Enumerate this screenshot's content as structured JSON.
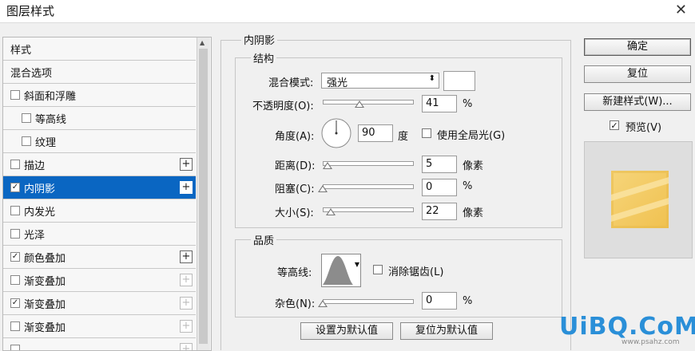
{
  "window": {
    "title": "图层样式",
    "close_symbol": "✕"
  },
  "style_list": [
    {
      "label": "样式",
      "has_checkbox": false,
      "checked": false,
      "indent": 0,
      "plus": "none",
      "selected": false
    },
    {
      "label": "混合选项",
      "has_checkbox": false,
      "checked": false,
      "indent": 0,
      "plus": "none",
      "selected": false
    },
    {
      "label": "斜面和浮雕",
      "has_checkbox": true,
      "checked": false,
      "indent": 0,
      "plus": "none",
      "selected": false
    },
    {
      "label": "等高线",
      "has_checkbox": true,
      "checked": false,
      "indent": 1,
      "plus": "none",
      "selected": false
    },
    {
      "label": "纹理",
      "has_checkbox": true,
      "checked": false,
      "indent": 1,
      "plus": "none",
      "selected": false
    },
    {
      "label": "描边",
      "has_checkbox": true,
      "checked": false,
      "indent": 0,
      "plus": "active",
      "selected": false
    },
    {
      "label": "内阴影",
      "has_checkbox": true,
      "checked": true,
      "indent": 0,
      "plus": "active",
      "selected": true
    },
    {
      "label": "内发光",
      "has_checkbox": true,
      "checked": false,
      "indent": 0,
      "plus": "none",
      "selected": false
    },
    {
      "label": "光泽",
      "has_checkbox": true,
      "checked": false,
      "indent": 0,
      "plus": "none",
      "selected": false
    },
    {
      "label": "颜色叠加",
      "has_checkbox": true,
      "checked": true,
      "indent": 0,
      "plus": "active",
      "selected": false
    },
    {
      "label": "渐变叠加",
      "has_checkbox": true,
      "checked": false,
      "indent": 0,
      "plus": "dim",
      "selected": false
    },
    {
      "label": "渐变叠加",
      "has_checkbox": true,
      "checked": true,
      "indent": 0,
      "plus": "dim",
      "selected": false
    },
    {
      "label": "渐变叠加",
      "has_checkbox": true,
      "checked": false,
      "indent": 0,
      "plus": "dim",
      "selected": false
    },
    {
      "label": "",
      "has_checkbox": true,
      "checked": false,
      "indent": 0,
      "plus": "dim",
      "selected": false
    }
  ],
  "section_title": "内阴影",
  "structure": {
    "legend": "结构",
    "blend_mode": {
      "label": "混合模式:",
      "value": "强光"
    },
    "opacity": {
      "label": "不透明度(O):",
      "value": "41",
      "unit": "%",
      "level": 0.41
    },
    "angle": {
      "label": "角度(A):",
      "value": "90",
      "unit": "度",
      "global_light_label": "使用全局光(G)",
      "global_light_checked": false
    },
    "distance": {
      "label": "距离(D):",
      "value": "5",
      "unit": "像素",
      "level": 0.05
    },
    "choke": {
      "label": "阻塞(C):",
      "value": "0",
      "unit": "%",
      "level": 0
    },
    "size": {
      "label": "大小(S):",
      "value": "22",
      "unit": "像素",
      "level": 0.09
    }
  },
  "quality": {
    "legend": "品质",
    "contour": {
      "label": "等高线:",
      "antialias_label": "消除锯齿(L)",
      "antialias_checked": false
    },
    "noise": {
      "label": "杂色(N):",
      "value": "0",
      "unit": "%",
      "level": 0
    }
  },
  "bottom_buttons": {
    "make_default": "设置为默认值",
    "reset_default": "复位为默认值"
  },
  "right": {
    "ok": "确定",
    "reset": "复位",
    "new_style": "新建样式(W)...",
    "preview_label": "预览(V)",
    "preview_checked": true
  },
  "watermark": {
    "main": "UiBQ.CoM",
    "sub": "www.psahz.com"
  },
  "colors": {
    "selection": "#0a66c2",
    "preview_fill": "#f3c95e"
  }
}
